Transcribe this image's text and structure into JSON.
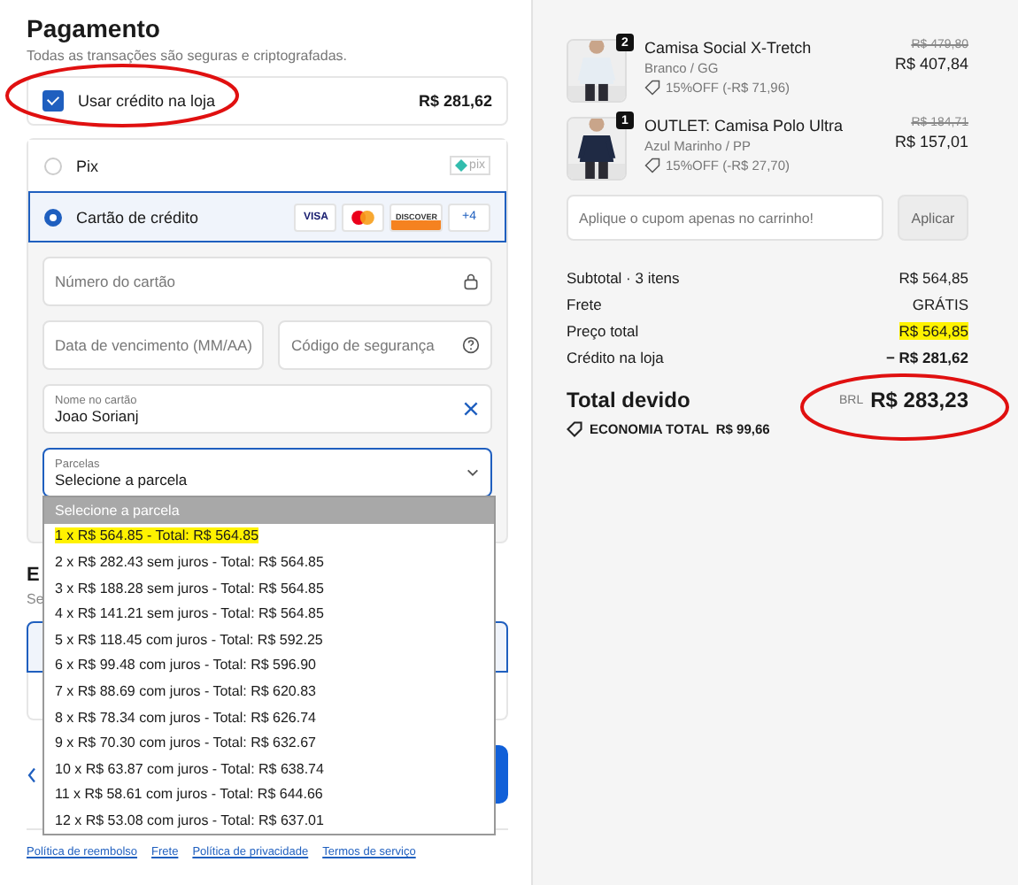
{
  "payment": {
    "title": "Pagamento",
    "subtitle": "Todas as transações são seguras e criptografadas.",
    "store_credit": {
      "label": "Usar crédito na loja",
      "amount": "R$ 281,62",
      "checked": true
    },
    "methods": [
      {
        "kind": "pix",
        "label": "Pix",
        "logo": "pix",
        "selected": false
      },
      {
        "kind": "card",
        "label": "Cartão de crédito",
        "brands": [
          {
            "kind": "visa",
            "label": "VISA"
          },
          {
            "kind": "mastercard"
          },
          {
            "kind": "discover",
            "label": "DISCOVER"
          }
        ],
        "more": "+4",
        "selected": true
      }
    ],
    "fields": {
      "card_number": {
        "placeholder": "Número do cartão"
      },
      "expiry": {
        "placeholder": "Data de vencimento (MM/AA)"
      },
      "cvv": {
        "placeholder": "Código de segurança"
      },
      "name": {
        "label": "Nome no cartão",
        "value": "Joao Sorianj"
      },
      "installments": {
        "label": "Parcelas",
        "value": "Selecione a parcela",
        "expanded": true,
        "options": [
          {
            "text": "Selecione a parcela",
            "selected": true,
            "highlighted": false
          },
          {
            "text": "1 x R$ 564.85 - Total: R$ 564.85",
            "selected": false,
            "highlighted": true
          },
          {
            "text": "2 x R$ 282.43 sem juros - Total: R$ 564.85",
            "selected": false,
            "highlighted": false
          },
          {
            "text": "3 x R$ 188.28 sem juros - Total: R$ 564.85",
            "selected": false,
            "highlighted": false
          },
          {
            "text": "4 x R$ 141.21 sem juros - Total: R$ 564.85",
            "selected": false,
            "highlighted": false
          },
          {
            "text": "5 x R$ 118.45 com juros - Total: R$ 592.25",
            "selected": false,
            "highlighted": false
          },
          {
            "text": "6 x R$ 99.48 com juros - Total: R$ 596.90",
            "selected": false,
            "highlighted": false
          },
          {
            "text": "7 x R$ 88.69 com juros - Total: R$ 620.83",
            "selected": false,
            "highlighted": false
          },
          {
            "text": "8 x R$ 78.34 com juros - Total: R$ 626.74",
            "selected": false,
            "highlighted": false
          },
          {
            "text": "9 x R$ 70.30 com juros - Total: R$ 632.67",
            "selected": false,
            "highlighted": false
          },
          {
            "text": "10 x R$ 63.87 com juros - Total: R$ 638.74",
            "selected": false,
            "highlighted": false
          },
          {
            "text": "11 x R$ 58.61 com juros - Total: R$ 644.66",
            "selected": false,
            "highlighted": false
          },
          {
            "text": "12 x R$ 53.08 com juros - Total: R$ 637.01",
            "selected": false,
            "highlighted": false
          }
        ]
      }
    }
  },
  "next_section": {
    "title": "E",
    "subtitle": "Se"
  },
  "footer_links": [
    "Política de reembolso",
    "Frete",
    "Política de privacidade",
    "Termos de serviço"
  ],
  "order": {
    "items": [
      {
        "quantity": "2",
        "name": "Camisa Social X-Tretch",
        "variant": "Branco / GG",
        "discount": "15%OFF (-R$ 71,96)",
        "old_price": "R$ 479,80",
        "price": "R$ 407,84"
      },
      {
        "quantity": "1",
        "name": "OUTLET: Camisa Polo Ultra",
        "variant": "Azul Marinho / PP",
        "discount": "15%OFF (-R$ 27,70)",
        "old_price": "R$ 184,71",
        "price": "R$ 157,01"
      }
    ],
    "coupon": {
      "placeholder": "Aplique o cupom apenas no carrinho!",
      "button": "Aplicar"
    },
    "summary": [
      {
        "label": "Subtotal · 3 itens",
        "value": "R$ 564,85",
        "highlighted": false,
        "bold": false
      },
      {
        "label": "Frete",
        "value": "GRÁTIS",
        "highlighted": false,
        "bold": false
      },
      {
        "label": "Preço total",
        "value": "R$ 564,85",
        "highlighted": true,
        "bold": false
      },
      {
        "label": "Crédito na loja",
        "value": "− R$ 281,62",
        "highlighted": false,
        "bold": true
      }
    ],
    "total": {
      "label": "Total devido",
      "currency": "BRL",
      "value": "R$ 283,23"
    },
    "savings": {
      "label": "ECONOMIA TOTAL",
      "value": "R$ 99,66"
    }
  }
}
